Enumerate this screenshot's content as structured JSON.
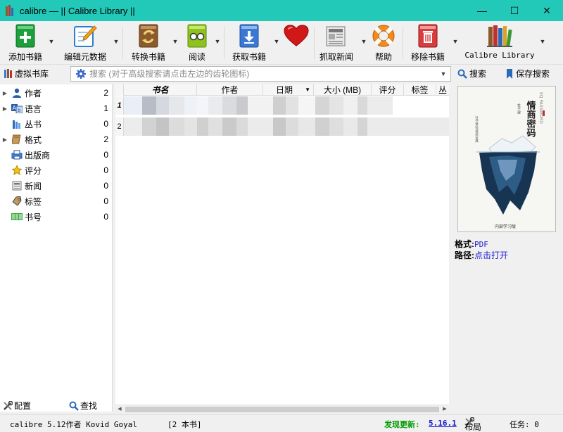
{
  "window": {
    "title": "calibre — || Calibre Library ||",
    "minimize": "—",
    "maximize": "☐",
    "close": "✕"
  },
  "toolbar": {
    "items": [
      {
        "label": "添加书籍",
        "icon": "add-book-icon"
      },
      {
        "label": "编辑元数据",
        "icon": "edit-metadata-icon"
      },
      {
        "label": "转换书籍",
        "icon": "convert-book-icon"
      },
      {
        "label": "阅读",
        "icon": "read-book-icon"
      },
      {
        "label": "获取书籍",
        "icon": "get-books-icon"
      },
      {
        "label": "",
        "icon": "donate-heart-icon"
      },
      {
        "label": "抓取新闻",
        "icon": "fetch-news-icon"
      },
      {
        "label": "帮助",
        "icon": "help-lifebuoy-icon"
      },
      {
        "label": "移除书籍",
        "icon": "remove-book-icon"
      },
      {
        "label": "Calibre Library",
        "icon": "library-icon"
      }
    ]
  },
  "search": {
    "virtual_library": "虚拟书库",
    "placeholder": "搜索 (对于高级搜索请点击左边的齿轮图标)",
    "search_button": "搜索",
    "save_search_button": "保存搜索"
  },
  "tag_browser": {
    "items": [
      {
        "name": "作者",
        "count": "2",
        "expandable": true,
        "icon": "author-icon"
      },
      {
        "name": "语言",
        "count": "1",
        "expandable": true,
        "icon": "language-icon"
      },
      {
        "name": "丛书",
        "count": "0",
        "expandable": false,
        "icon": "series-icon"
      },
      {
        "name": "格式",
        "count": "2",
        "expandable": true,
        "icon": "format-icon"
      },
      {
        "name": "出版商",
        "count": "0",
        "expandable": false,
        "icon": "publisher-icon"
      },
      {
        "name": "评分",
        "count": "0",
        "expandable": false,
        "icon": "rating-star-icon"
      },
      {
        "name": "新闻",
        "count": "0",
        "expandable": false,
        "icon": "news-icon"
      },
      {
        "name": "标签",
        "count": "0",
        "expandable": false,
        "icon": "tag-icon"
      },
      {
        "name": "书号",
        "count": "0",
        "expandable": false,
        "icon": "identifier-icon"
      }
    ],
    "configure_button": "配置",
    "find_button": "查找"
  },
  "book_list": {
    "columns": [
      "书名",
      "作者",
      "日期",
      "大小 (MB)",
      "评分",
      "标签",
      "丛"
    ],
    "sorted_column_indicator": "▼",
    "row_numbers": [
      "1",
      "2"
    ]
  },
  "book_details": {
    "format_label": "格式:",
    "format_value": "PDF",
    "path_label": "路径:",
    "path_value": "点击打开",
    "cover": {
      "title": "情商密码",
      "subtitle_en": "EQ PASSWORD",
      "author": "杜子建",
      "series": "社交体验/情商宝典",
      "publisher": "内部学习版"
    }
  },
  "status_bar": {
    "version_author": "calibre 5.12作者 Kovid Goyal",
    "book_count": "[2 本书]",
    "update_label": "发现更新:",
    "update_version": "5.16.1",
    "layout_button": "布局",
    "jobs_label": "任务: 0"
  },
  "colors": {
    "titlebar": "#22c9b8",
    "link": "#2020d0",
    "update_green": "#009900"
  }
}
